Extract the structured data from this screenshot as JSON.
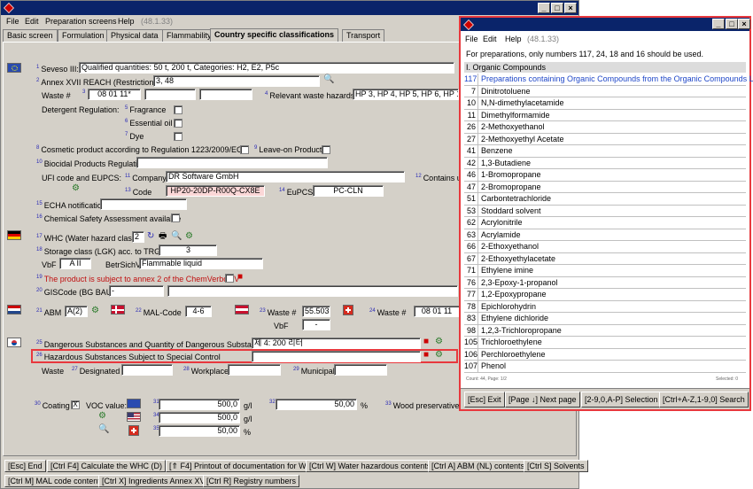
{
  "main": {
    "menu": [
      "File",
      "Edit",
      "Preparation screens",
      "Help"
    ],
    "version": "(48.1.33)",
    "tabs": [
      "Basic screen",
      "Formulation",
      "Physical data",
      "Flammability",
      "Country specific classifications",
      "Transport"
    ],
    "seveso": {
      "num": "1",
      "label": "Seveso III:",
      "value": "Qualified quantities: 50 t, 200 t, Categories: H2, E2, P5c"
    },
    "annex": {
      "num": "2",
      "label": "Annex XVII REACH (Restrictions)",
      "value": "3, 48"
    },
    "waste": {
      "label": "Waste #",
      "num": "3",
      "value": "08 01 11*",
      "rel_num": "4",
      "rel_label": "Relevant waste hazards",
      "rel_value": "HP 3, HP 4, HP 5, HP 6, HP 10,"
    },
    "detergent": {
      "label": "Detergent Regulation:",
      "fragrance_num": "5",
      "fragrance": "Fragrance",
      "oil_num": "6",
      "oil": "Essential oil",
      "dye_num": "7",
      "dye": "Dye"
    },
    "cosmetic": {
      "num": "8",
      "label": "Cosmetic product according to Regulation 1223/2009/EC",
      "leave_num": "9",
      "leave": "Leave-on Product"
    },
    "biocidal": {
      "num": "10",
      "label": "Biocidal Products Regulation"
    },
    "ufi": {
      "label": "UFI code and EUPCS:",
      "company_num": "11",
      "company": "Company",
      "company_value": "DR Software GmbH",
      "contains_num": "12",
      "contains": "Contains un",
      "code_num": "13",
      "code": "Code",
      "code_value": "HP20-20DP-R00Q-CX8E",
      "eupcs_num": "14",
      "eupcs": "EuPCS",
      "eupcs_value": "PC-CLN"
    },
    "echa": {
      "num": "15",
      "label": "ECHA notification"
    },
    "csa": {
      "num": "16",
      "label": "Chemical Safety Assessment available"
    },
    "whc": {
      "num": "17",
      "label": "WHC (Water hazard class)",
      "value": "2"
    },
    "lgk": {
      "num": "18",
      "label": "Storage class (LGK) acc. to TRGS510",
      "value": "3"
    },
    "vbf": {
      "label": "VbF",
      "value": "A II",
      "betr_label": "BetrSichV",
      "betr_value": "Flammable liquid"
    },
    "chem": {
      "num": "19",
      "label": "The product is subject to annex 2 of the ChemVerbotsV"
    },
    "gis": {
      "num": "20",
      "label": "GISCode (BG BAU)",
      "value": "-"
    },
    "abm": {
      "num": "21",
      "label": "ABM",
      "value": "A(2)",
      "mal_num": "22",
      "mal_label": "MAL-Code",
      "mal_value": "4-6",
      "w23_num": "23",
      "w23_label": "Waste #",
      "w23_value": "55.503",
      "w24_num": "24",
      "w24_label": "Waste #",
      "w24_value": "08 01 11",
      "vbf_label": "VbF",
      "vbf_value": "-"
    },
    "korea": {
      "d_num": "25",
      "d_label": "Dangerous Substances and Quantity of Dangerous Substances",
      "d_value": "제 4: 200 리터",
      "h_num": "26",
      "h_label": "Hazardous Substances Subject to Special Control",
      "waste": "Waste",
      "des_num": "27",
      "des": "Designated",
      "wp_num": "28",
      "wp": "Workplace",
      "mun_num": "29",
      "mun": "Municipal"
    },
    "voc": {
      "coat_num": "30",
      "coat": "Coating",
      "check": "X",
      "label": "VOC value:",
      "r1_num": "31",
      "r1_val": "500,0",
      "r1_unit": "g/l",
      "r1b_num": "32",
      "r1b_val": "50,00",
      "r1b_unit": "%",
      "wood_num": "33",
      "wood": "Wood preservative",
      "r2_num": "34",
      "r2_val": "500,0",
      "r2_unit": "g/l",
      "r3_num": "35",
      "r3_val": "50,00",
      "r3_unit": "%"
    },
    "bottom1": [
      "[Esc] End",
      "[Ctrl F4] Calculate the WHC (D)",
      "[⇑ F4] Printout of documentation for WHC",
      "[Ctrl W] Water hazardous contents",
      "[Ctrl A] ABM (NL) contents",
      "[Ctrl S] Solvents"
    ],
    "bottom2": [
      "[Ctrl M] MAL code contents",
      "[Ctrl X] Ingredients Annex XVII",
      "[Ctrl R] Registry numbers"
    ]
  },
  "popup": {
    "menu": [
      "File",
      "Edit",
      "Help"
    ],
    "version": "(48.1.33)",
    "note": "For preparations, only numbers 117, 24, 18 and 16 should be used.",
    "header": "I. Organic Compounds",
    "rows": [
      {
        "n": "117",
        "t": "Preparations containing Organic Compounds from the Organic Compounds List"
      },
      {
        "n": "7",
        "t": "Dinitrotoluene"
      },
      {
        "n": "10",
        "t": "N,N-dimethylacetamide"
      },
      {
        "n": "11",
        "t": "Dimethylformamide"
      },
      {
        "n": "26",
        "t": "2-Methoxyethanol"
      },
      {
        "n": "27",
        "t": "2-Methoxyethyl Acetate"
      },
      {
        "n": "41",
        "t": "Benzene"
      },
      {
        "n": "42",
        "t": "1,3-Butadiene"
      },
      {
        "n": "46",
        "t": "1-Bromopropane"
      },
      {
        "n": "47",
        "t": "2-Bromopropane"
      },
      {
        "n": "51",
        "t": "Carbontetrachloride"
      },
      {
        "n": "53",
        "t": "Stoddard solvent"
      },
      {
        "n": "62",
        "t": "Acrylonitrile"
      },
      {
        "n": "63",
        "t": "Acrylamide"
      },
      {
        "n": "66",
        "t": "2-Ethoxyethanol"
      },
      {
        "n": "67",
        "t": "2-Ethoxyethylacetate"
      },
      {
        "n": "71",
        "t": "Ethylene imine"
      },
      {
        "n": "76",
        "t": "2,3-Epoxy-1-propanol"
      },
      {
        "n": "77",
        "t": "1,2-Epoxypropane"
      },
      {
        "n": "78",
        "t": "Epichlorohydrin"
      },
      {
        "n": "83",
        "t": "Ethylene dichloride"
      },
      {
        "n": "98",
        "t": "1,2,3-Trichloropropane"
      },
      {
        "n": "105",
        "t": "Trichloroethylene"
      },
      {
        "n": "106",
        "t": "Perchloroethylene"
      },
      {
        "n": "107",
        "t": "Phenol"
      }
    ],
    "count": "Count: 44, Page: 1/2",
    "selected": "Selected: 0",
    "buttons": [
      "[Esc] Exit",
      "[Page ↓] Next page",
      "[2-9,0,A-P] Selection",
      "[Ctrl+A-Z,1-9,0] Search"
    ]
  },
  "colors": {
    "title_blue": "#0a246a",
    "highlight_red": "#e8383d",
    "link_blue": "#1f47c8"
  }
}
